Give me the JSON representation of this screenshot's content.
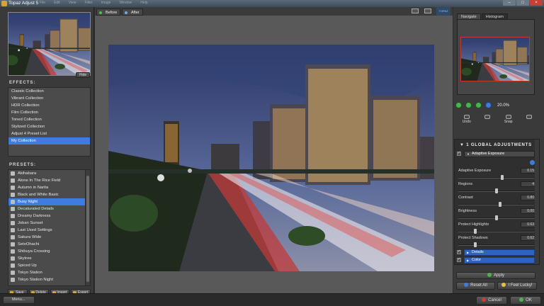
{
  "window": {
    "title": "Topaz Adjust 5",
    "menu": [
      "File",
      "Edit",
      "View",
      "Filter",
      "Image",
      "Window",
      "Help"
    ]
  },
  "colors": {
    "accent": "#3e7ce0",
    "zoom_green": "#4db24d",
    "close_red": "#c64034",
    "section_blue": "#2f63c2"
  },
  "left": {
    "hide_label": "Hide",
    "effects_title": "EFFECTS:",
    "effects": [
      "Classic Collection",
      "Vibrant Collection",
      "HDR Collection",
      "Film Collection",
      "Toned Collection",
      "Stylized Collection",
      "Adjust 4 Preset List",
      "My Collection"
    ],
    "effects_selected": 7,
    "presets_title": "PRESETS:",
    "presets": [
      "Akihabara",
      "Alone In The Rice Field",
      "Autumn in Narita",
      "Black and White Basic",
      "Busy Night",
      "Decaturated Details",
      "Dreamy Darkness",
      "Joban Sunset",
      "Last Used Settings",
      "Sakura Wide",
      "SetoOhachi",
      "Shibuya Crossing",
      "Skytree",
      "Spiced Up",
      "Tokyo Station",
      "Tokyo Station Night"
    ],
    "presets_selected": 4,
    "preset_buttons": [
      "Save",
      "Delete",
      "Import",
      "Export"
    ]
  },
  "center": {
    "before_label": "Before",
    "after_label": "After",
    "logo_text": "TOPAZ"
  },
  "right": {
    "tabs": [
      "Navigate",
      "Histogram"
    ],
    "zoom_value": "20.0%",
    "tools": [
      "Undo",
      "",
      "Snap",
      ""
    ],
    "global_title": "1 GLOBAL ADJUSTMENTS",
    "adaptive_exposure_header": "Adaptive Exposure",
    "sliders": [
      {
        "label": "Adaptive Exposure",
        "value": "0.15",
        "pos": 0.58
      },
      {
        "label": "Regions",
        "value": "4",
        "pos": 0.5
      },
      {
        "label": "Contrast",
        "value": "0.80",
        "pos": 0.55
      },
      {
        "label": "Brightness",
        "value": "0.00",
        "pos": 0.5
      },
      {
        "label": "Protect Highlights",
        "value": "0.63",
        "pos": 0.22
      },
      {
        "label": "Protect Shadows",
        "value": "0.62",
        "pos": 0.22
      }
    ],
    "details_label": "Details",
    "color_label": "Color",
    "apply_label": "Apply",
    "reset_label": "Reset All",
    "lucky_label": "I Feel Lucky!"
  },
  "bottom": {
    "menu_label": "Menu...",
    "cancel_label": "Cancel",
    "ok_label": "OK"
  }
}
